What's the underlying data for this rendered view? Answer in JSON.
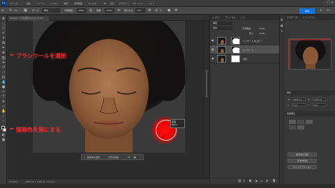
{
  "app": {
    "logo": "Ps"
  },
  "menubar": {
    "items": [
      "ファイル",
      "編集",
      "イメージ",
      "レイヤー",
      "書式",
      "選択範囲",
      "フィルター",
      "3D",
      "表示",
      "プラグイン",
      "ウィンドウ",
      "ヘルプ"
    ]
  },
  "options": {
    "size": "90",
    "mode_label": "モード:",
    "mode_value": "通常",
    "opacity_label": "不透明度:",
    "opacity_value": "100%",
    "flow_label": "流量:",
    "flow_value": "100%",
    "smoothing_label": "滑らかさ:",
    "smoothing_value": "10%",
    "angle": "0°",
    "share_label": "共有"
  },
  "document": {
    "tab_title": "Cheese-ヘアの選択.psd @ 33.3%"
  },
  "annotations": {
    "brush": "ブラシツールを選択",
    "color": "描画色を黒にする"
  },
  "brush_tip": {
    "line1": "直径",
    "line2": "90px"
  },
  "context_bar": {
    "item1": "被写体を選択",
    "item2": "背景を削除"
  },
  "status": {
    "zoom": "33.33%",
    "info": "1800 px × 1200 px (72 ppi)"
  },
  "layers": {
    "tabs": [
      "レイヤー",
      "チャンネル",
      "パス"
    ],
    "filter_label": "種類",
    "blend": "通常",
    "opacity_label": "不透明度:",
    "opacity_value": "100%",
    "fill_label": "塗り:",
    "fill_value": "100%",
    "rows": [
      {
        "name": "レイヤー 1 のコピー"
      },
      {
        "name": "レイヤー 1"
      },
      {
        "name": "背景"
      }
    ]
  },
  "properties": {
    "tabs": [
      "ナビゲーター",
      "ヒストグラム"
    ],
    "section1": "属性",
    "section2": "色調補正",
    "labels": [
      "W",
      "H",
      "X",
      "Y"
    ],
    "values": [
      "1800 px",
      "1200 px",
      "0 px",
      "0 px"
    ],
    "buttons": [
      "被写体を選択",
      "背景を削除",
      "クイックアクション"
    ]
  },
  "colors": {
    "accent": "#1473e6",
    "annotation": "#ff2a2a",
    "brush": "#e80000"
  }
}
